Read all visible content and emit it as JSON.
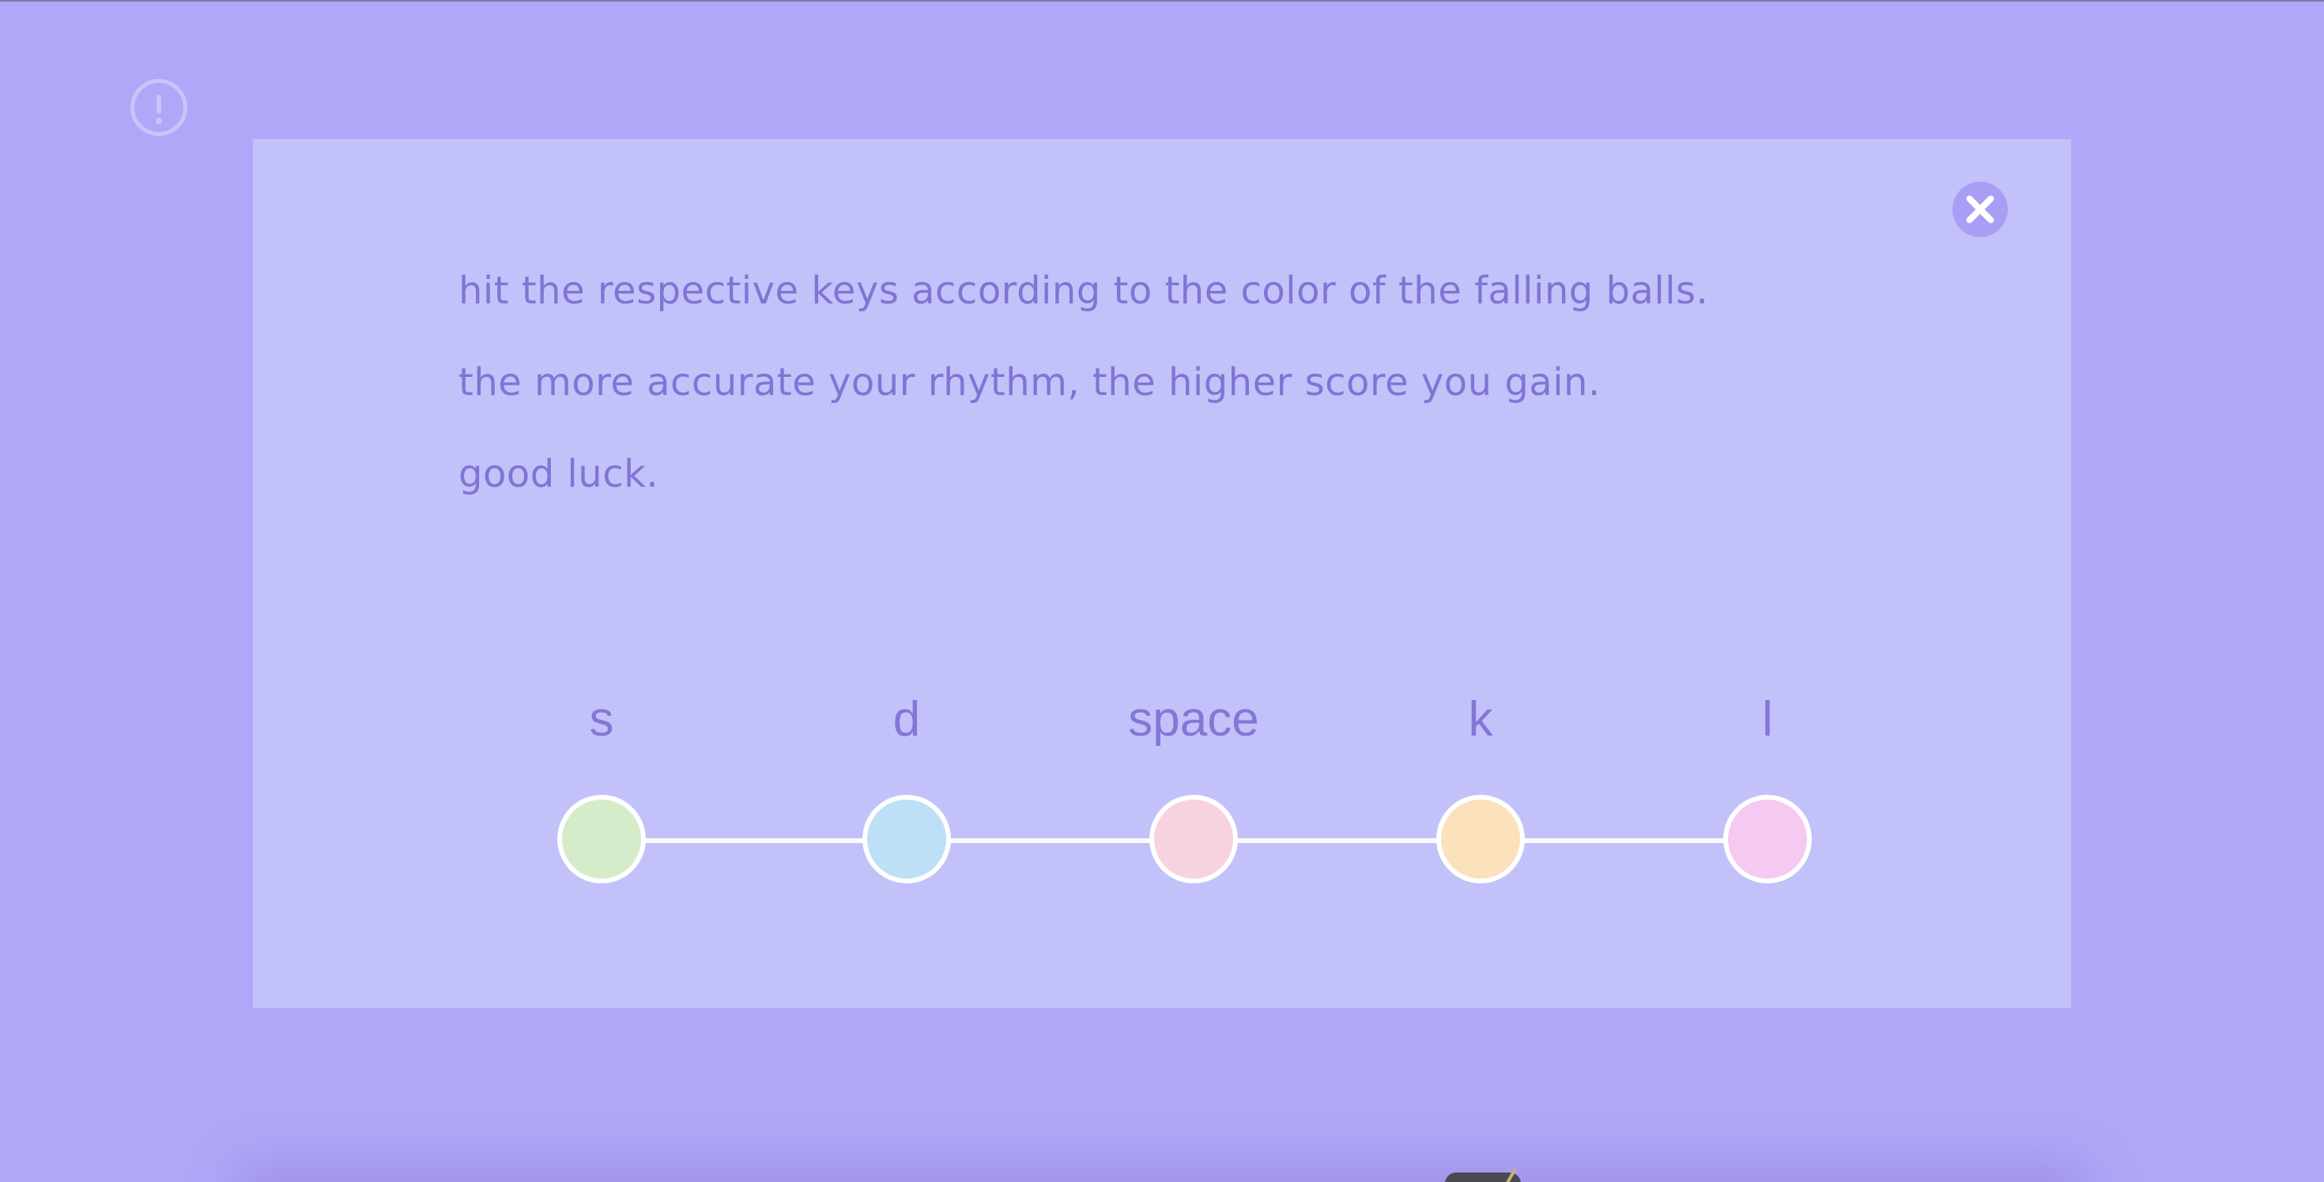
{
  "instructions": {
    "lines": [
      "hit the respective keys according to the color of the falling balls.",
      "the more accurate your rhythm, the higher score you gain.",
      "good luck."
    ]
  },
  "keys": [
    {
      "label": "s",
      "color": "#d5ecca"
    },
    {
      "label": "d",
      "color": "#bde0f7"
    },
    {
      "label": "space",
      "color": "#f6d3df"
    },
    {
      "label": "k",
      "color": "#fbe1bc"
    },
    {
      "label": "l",
      "color": "#f6c9f3"
    }
  ],
  "colors": {
    "background": "#b0a7f8",
    "panel": "#c3c1fa",
    "text": "#7f75d4",
    "close_button": "#a99ef5"
  },
  "icons": {
    "info": "exclamation-circle-icon",
    "close": "close-icon"
  }
}
